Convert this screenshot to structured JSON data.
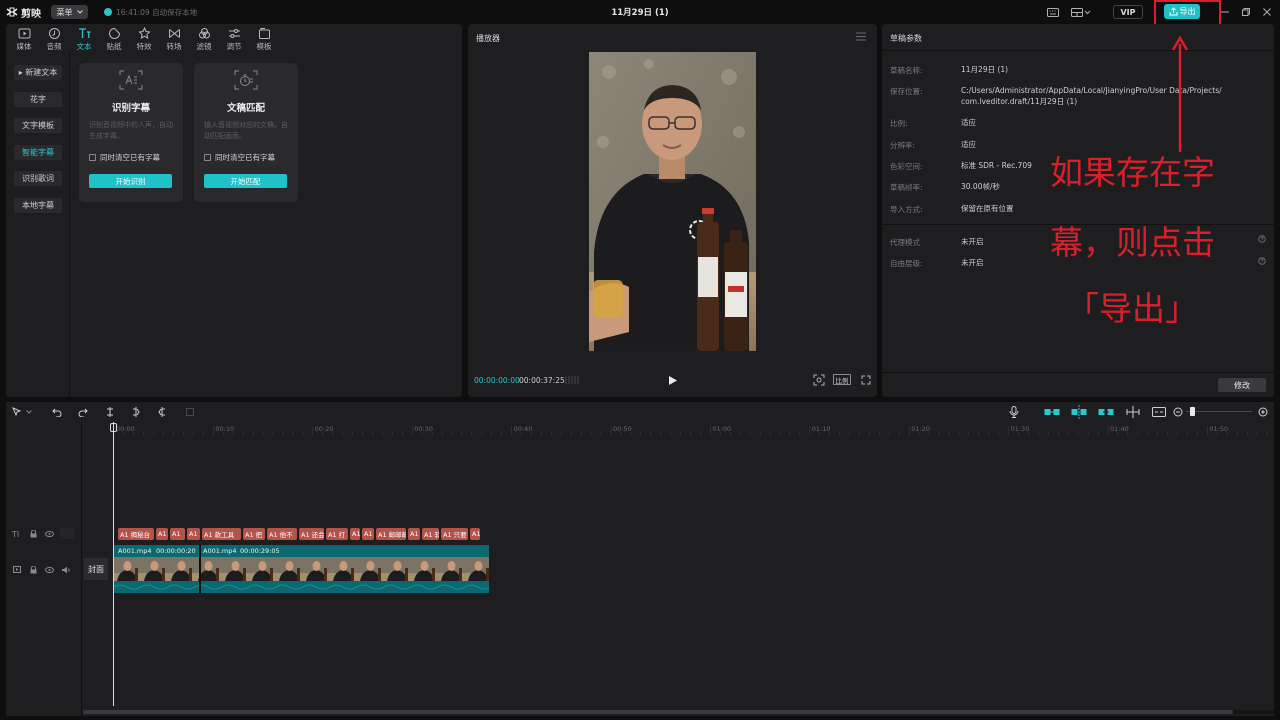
{
  "titlebar": {
    "app_name": "剪映",
    "menu_label": "菜单",
    "autosave": "16:41:09 自动保存本地",
    "document_title": "11月29日 (1)",
    "vip_label": "VIP",
    "export_label": "导出",
    "icons": [
      "keyboard-icon",
      "layout-icon",
      "minimize-icon",
      "restore-icon",
      "close-icon"
    ]
  },
  "tool_tabs": [
    {
      "label": "媒体",
      "icon": "media-icon"
    },
    {
      "label": "音频",
      "icon": "audio-icon"
    },
    {
      "label": "文本",
      "icon": "text-icon",
      "active": true
    },
    {
      "label": "贴纸",
      "icon": "sticker-icon"
    },
    {
      "label": "特效",
      "icon": "effects-icon"
    },
    {
      "label": "转场",
      "icon": "transition-icon"
    },
    {
      "label": "滤镜",
      "icon": "filter-icon"
    },
    {
      "label": "调节",
      "icon": "adjust-icon"
    },
    {
      "label": "模板",
      "icon": "template-icon"
    }
  ],
  "text_nav": [
    {
      "label": "▸ 新建文本"
    },
    {
      "label": "花字"
    },
    {
      "label": "文字模板"
    },
    {
      "label": "智能字幕",
      "active": true
    },
    {
      "label": "识别歌词"
    },
    {
      "label": "本地字幕"
    }
  ],
  "cards": [
    {
      "title": "识别字幕",
      "desc": "识别音视频中的人声，自动生成字幕。",
      "checkbox": "同时清空已有字幕",
      "button": "开始识别"
    },
    {
      "title": "文稿匹配",
      "desc": "输入音视频对应的文稿，自动匹配画面。",
      "checkbox": "同时清空已有字幕",
      "button": "开始匹配"
    }
  ],
  "player": {
    "title": "播放器",
    "current_time": "00:00:00:00",
    "duration": "00:00:37:25",
    "ratio_label": "比例"
  },
  "props": {
    "title": "草稿参数",
    "rows": [
      {
        "label": "草稿名称:",
        "value": "11月29日 (1)"
      },
      {
        "label": "保存位置:",
        "value": "C:/Users/Administrator/AppData/Local/JianyingPro/User Data/Projects/",
        "value2": "com.lveditor.draft/11月29日 (1)"
      },
      {
        "label": "比例:",
        "value": "适应"
      },
      {
        "label": "分辨率:",
        "value": "适应"
      },
      {
        "label": "色彩空间:",
        "value": "标准 SDR - Rec.709"
      },
      {
        "label": "草稿帧率:",
        "value": "30.00帧/秒"
      },
      {
        "label": "导入方式:",
        "value": "保留在原有位置"
      },
      {
        "label": "代理模式",
        "value": "未开启"
      },
      {
        "label": "自由层级:",
        "value": "未开启"
      }
    ],
    "modify_label": "修改"
  },
  "timeline": {
    "ruler_ticks": [
      "00:00",
      "00:10",
      "00:20",
      "00:30",
      "00:40",
      "00:50",
      "01:00",
      "01:10",
      "01:20",
      "01:30",
      "01:40",
      "01:50"
    ],
    "subtitle_clips": [
      "A1 揭秘台",
      "A1",
      "A1",
      "A1",
      "A1 款工具",
      "A1 把",
      "A1 他不",
      "A1 还会",
      "A1 打",
      "A1",
      "A1",
      "A1 邮邮邮",
      "A1",
      "A1 软",
      "A1 只要",
      "A1"
    ],
    "video_clips": [
      {
        "name": "A001.mp4",
        "duration": "00:00:00:20"
      },
      {
        "name": "A001.mp4",
        "duration": "00:00:29:05"
      }
    ],
    "cover_label": "封面"
  },
  "annotation": {
    "line1": "如果存在字",
    "line2": "幕，则点击",
    "line3": "「导出」",
    "color": "#d9202a"
  },
  "colors": {
    "accent": "#20c1c9",
    "subtitle_clip": "#b4534a",
    "video_clip": "#0c6870"
  }
}
